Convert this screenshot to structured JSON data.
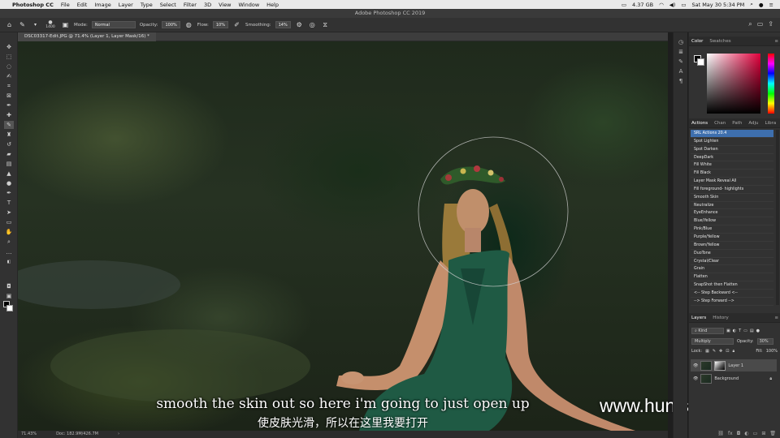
{
  "menubar": {
    "apple": "",
    "app_name": "Photoshop CC",
    "items": [
      "File",
      "Edit",
      "Image",
      "Layer",
      "Type",
      "Select",
      "Filter",
      "3D",
      "View",
      "Window",
      "Help"
    ],
    "storage": "4.37 GB",
    "clock": "Sat May 30  5:34 PM"
  },
  "window": {
    "title": "Adobe Photoshop CC 2019"
  },
  "options": {
    "brush_size": "1400",
    "mode_label": "Mode:",
    "mode_value": "Normal",
    "opacity_label": "Opacity:",
    "opacity_value": "100%",
    "flow_label": "Flow:",
    "flow_value": "10%",
    "smoothing_label": "Smoothing:",
    "smoothing_value": "14%"
  },
  "document": {
    "tab_title": "DSC03317-Edit.JPG @ 71.4% (Layer 1, Layer Mask/16) *"
  },
  "status": {
    "zoom": "71.43%",
    "doc": "Doc: 182.9M/426.7M"
  },
  "subtitles": {
    "en": "smooth the skin out so here i'm going to just open up",
    "zh": "使皮肤光滑，所以在这里我要打开",
    "watermark": "www.hunls.com"
  },
  "color_panel": {
    "tabs": [
      "Color",
      "Swatches"
    ]
  },
  "actions_panel": {
    "tabs": [
      "Actions",
      "Chan",
      "Path",
      "Adju",
      "Libra"
    ],
    "items": [
      "SRL Actions 20.4",
      "Spot Lighten",
      "Spot Darken",
      "DeepDark",
      "Fill White",
      "Fill Black",
      "Layer Mask Reveal All",
      "Fill foreground- highlights",
      "Smooth Skin",
      "Neutralize",
      "EyeEnhance",
      "Blue/Yellow",
      "Pink/Blue",
      "Purple/Yellow",
      "Brown/Yellow",
      "DuoTone",
      "Crystal/Clear",
      "Grain",
      "Flatten",
      "SnapShot then Flatten",
      "<-- Step Backward <--",
      "--> Step Forward -->"
    ],
    "selected_index": 0
  },
  "layers_panel": {
    "tabs": [
      "Layers",
      "History"
    ],
    "kind_label": "Kind",
    "blend_mode": "Multiply",
    "opacity_label": "Opacity:",
    "opacity_value": "30%",
    "lock_label": "Lock:",
    "fill_label": "Fill:",
    "fill_value": "100%",
    "layers": [
      {
        "name": "Layer 1",
        "selected": true
      },
      {
        "name": "Background",
        "selected": false
      }
    ]
  }
}
